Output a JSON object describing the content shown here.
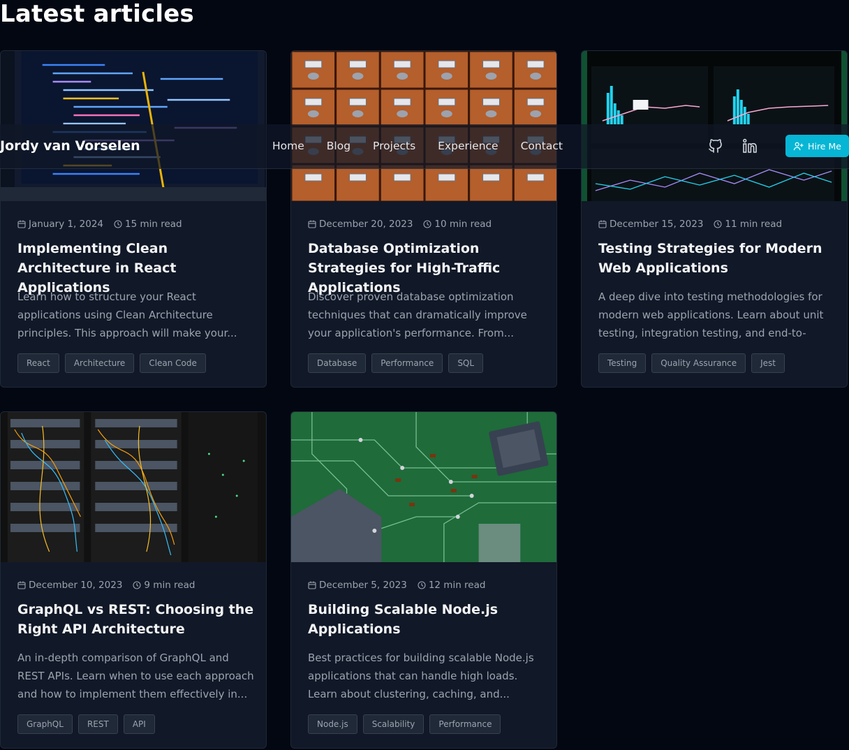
{
  "page_heading": "Latest articles",
  "nav": {
    "brand": "Jordy van Vorselen",
    "links": [
      "Home",
      "Blog",
      "Projects",
      "Experience",
      "Contact"
    ],
    "github_icon": "github-icon",
    "linkedin_icon": "linkedin-icon",
    "hire_label": "Hire Me",
    "hire_icon": "user-plus-icon",
    "accent_color": "#06b6d4"
  },
  "articles": [
    {
      "image": "laptop-code-image",
      "date": "January 1, 2024",
      "read_time": "15 min read",
      "title": "Implementing Clean Architecture in React Applications",
      "excerpt": "Learn how to structure your React applications using Clean Architecture principles. This approach will make your...",
      "tags": [
        "React",
        "Architecture",
        "Clean Code"
      ]
    },
    {
      "image": "card-catalog-drawers-image",
      "date": "December 20, 2023",
      "read_time": "10 min read",
      "title": "Database Optimization Strategies for High-Traffic Applications",
      "excerpt": "Discover proven database optimization techniques that can dramatically improve your application's performance. From...",
      "tags": [
        "Database",
        "Performance",
        "SQL"
      ]
    },
    {
      "image": "analytics-dashboard-image",
      "date": "December 15, 2023",
      "read_time": "11 min read",
      "title": "Testing Strategies for Modern Web Applications",
      "excerpt": "A deep dive into testing methodologies for modern web applications. Learn about unit testing, integration testing, and end-to-end...",
      "tags": [
        "Testing",
        "Quality Assurance",
        "Jest"
      ]
    },
    {
      "image": "server-rack-cables-image",
      "date": "December 10, 2023",
      "read_time": "9 min read",
      "title": "GraphQL vs REST: Choosing the Right API Architecture",
      "excerpt": "An in-depth comparison of GraphQL and REST APIs. Learn when to use each approach and how to implement them effectively in...",
      "tags": [
        "GraphQL",
        "REST",
        "API"
      ]
    },
    {
      "image": "circuit-board-image",
      "date": "December 5, 2023",
      "read_time": "12 min read",
      "title": "Building Scalable Node.js Applications",
      "excerpt": "Best practices for building scalable Node.js applications that can handle high loads. Learn about clustering, caching, and...",
      "tags": [
        "Node.js",
        "Scalability",
        "Performance"
      ]
    }
  ]
}
